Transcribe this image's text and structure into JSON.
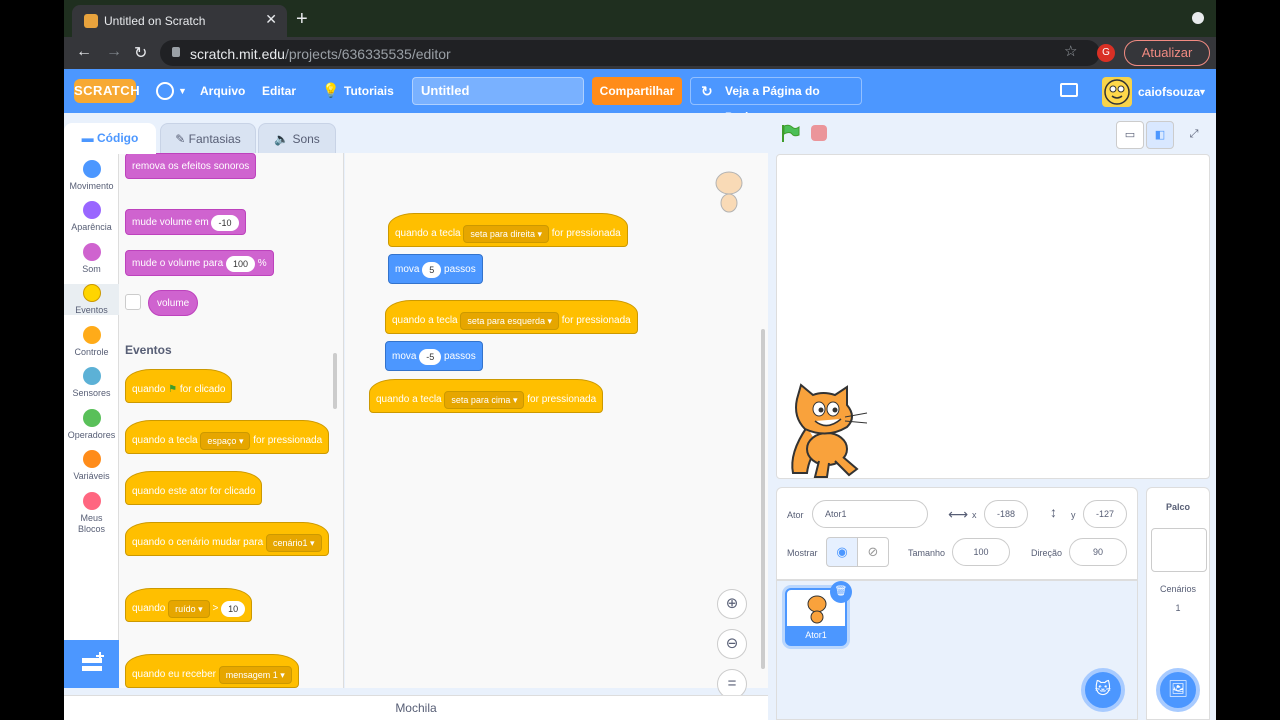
{
  "browser": {
    "tab_title": "Untitled on Scratch",
    "url_host": "scratch.mit.edu",
    "url_path": "/projects/636335535/editor",
    "update_label": "Atualizar",
    "profile_initial": "G"
  },
  "menu": {
    "logo": "SCRATCH",
    "file": "Arquivo",
    "edit": "Editar",
    "tutorials": "Tutoriais",
    "project_title": "Untitled",
    "share": "Compartilhar",
    "see_project": "Veja a Página do Projeto",
    "username": "caiofsouza"
  },
  "tabs": {
    "code": "Código",
    "costumes": "Fantasias",
    "sounds": "Sons"
  },
  "categories": [
    {
      "label": "Movimento",
      "color": "#4c97ff"
    },
    {
      "label": "Aparência",
      "color": "#9966ff"
    },
    {
      "label": "Som",
      "color": "#cf63cf"
    },
    {
      "label": "Eventos",
      "color": "#ffd500"
    },
    {
      "label": "Controle",
      "color": "#ffab19"
    },
    {
      "label": "Sensores",
      "color": "#5cb1d6"
    },
    {
      "label": "Operadores",
      "color": "#59c059"
    },
    {
      "label": "Variáveis",
      "color": "#ff8c1a"
    },
    {
      "label": "Meus Blocos",
      "color": "#ff6680"
    }
  ],
  "palette": {
    "remove_effects": "remova os efeitos sonoros",
    "change_volume": "mude volume em",
    "change_volume_val": "-10",
    "set_volume": "mude o volume para",
    "set_volume_val": "100",
    "set_volume_unit": "%",
    "volume": "volume",
    "events_heading": "Eventos",
    "when_flag_a": "quando",
    "when_flag_b": "for clicado",
    "when_key_a": "quando a tecla",
    "when_key_dd": "espaço",
    "when_key_b": "for pressionada",
    "when_sprite": "quando este ator for clicado",
    "when_backdrop_a": "quando o cenário mudar para",
    "when_backdrop_dd": "cenário1",
    "when_gt_a": "quando",
    "when_gt_dd": "ruído",
    "when_gt_op": ">",
    "when_gt_val": "10",
    "when_receive_a": "quando eu receber",
    "when_receive_dd": "mensagem 1"
  },
  "scripts": [
    {
      "hat_a": "quando a tecla",
      "key": "seta para direita",
      "hat_b": "for pressionada",
      "move": "mova",
      "steps": "5",
      "unit": "passos"
    },
    {
      "hat_a": "quando a tecla",
      "key": "seta para esquerda",
      "hat_b": "for pressionada",
      "move": "mova",
      "steps": "-5",
      "unit": "passos"
    },
    {
      "hat_a": "quando a tecla",
      "key": "seta para cima",
      "hat_b": "for pressionada"
    }
  ],
  "backpack": "Mochila",
  "sprite_info": {
    "sprite_label": "Ator",
    "sprite_name": "Ator1",
    "x_label": "x",
    "x": "-188",
    "y_label": "y",
    "y": "-127",
    "show_label": "Mostrar",
    "size_label": "Tamanho",
    "size": "100",
    "direction_label": "Direção",
    "direction": "90"
  },
  "sprite_list": [
    {
      "name": "Ator1"
    }
  ],
  "stage_panel": {
    "title": "Palco",
    "backdrops_label": "Cenários",
    "backdrops_count": "1"
  }
}
